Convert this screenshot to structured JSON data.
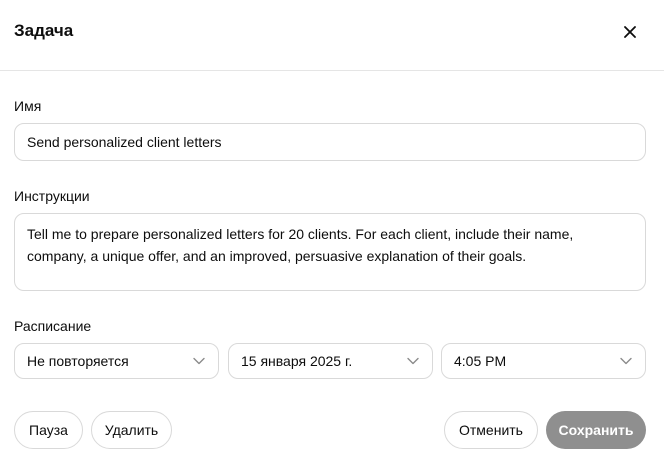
{
  "dialog": {
    "title": "Задача",
    "close_icon": "close-icon"
  },
  "name": {
    "label": "Имя",
    "value": "Send personalized client letters"
  },
  "instructions": {
    "label": "Инструкции",
    "value": "Tell me to prepare personalized letters for 20 clients. For each client, include their name, company, a unique offer, and an improved, persuasive explanation of their goals."
  },
  "schedule": {
    "label": "Расписание",
    "repeat": "Не повторяется",
    "date": "15 января 2025 г.",
    "time": "4:05 PM"
  },
  "actions": {
    "pause": "Пауза",
    "delete": "Удалить",
    "cancel": "Отменить",
    "save": "Сохранить"
  },
  "colors": {
    "save_button_bg": "#8f8f8f",
    "border": "#d9d9d9",
    "text": "#0d0d0d"
  }
}
